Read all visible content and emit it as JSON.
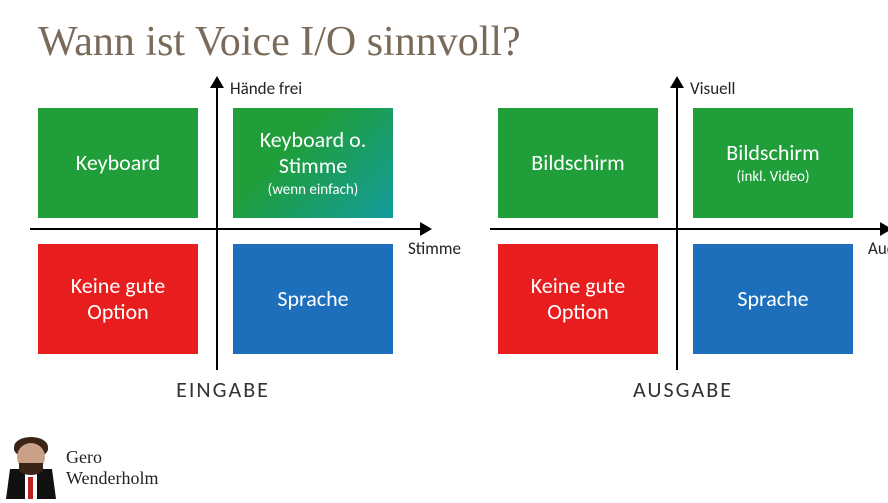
{
  "title": "Wann ist Voice I/O sinnvoll?",
  "left": {
    "yLabel": "Hände frei",
    "xLabel": "Stimme",
    "caption": "EINGABE",
    "tl": {
      "main": "Keyboard",
      "sub": ""
    },
    "tr": {
      "main": "Keyboard o. Stimme",
      "sub": "(wenn einfach)"
    },
    "bl": {
      "main": "Keine gute Option",
      "sub": ""
    },
    "br": {
      "main": "Sprache",
      "sub": ""
    }
  },
  "right": {
    "yLabel": "Visuell",
    "xLabel": "Audio",
    "caption": "AUSGABE",
    "tl": {
      "main": "Bildschirm",
      "sub": ""
    },
    "tr": {
      "main": "Bildschirm",
      "sub": "(inkl. Video)"
    },
    "bl": {
      "main": "Keine gute Option",
      "sub": ""
    },
    "br": {
      "main": "Sprache",
      "sub": ""
    }
  },
  "presenter": {
    "first": "Gero",
    "last": "Wenderholm"
  }
}
